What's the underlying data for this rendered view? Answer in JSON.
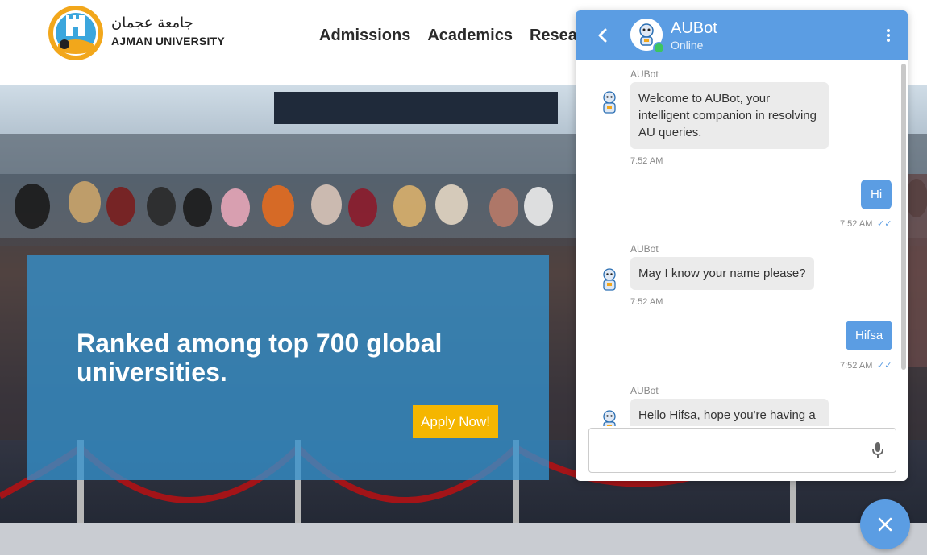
{
  "header": {
    "brand_ar": "جامعة عجمان",
    "brand_en": "AJMAN UNIVERSITY",
    "nav": [
      "Admissions",
      "Academics",
      "Resea"
    ]
  },
  "hero": {
    "title": "Ranked among top 700 global universities.",
    "apply_label": "Apply Now!"
  },
  "chat": {
    "bot_name": "AUBot",
    "status": "Online",
    "messages": [
      {
        "from": "bot",
        "sender": "AUBot",
        "text": "Welcome to AUBot, your intelligent companion in resolving AU queries.",
        "time": "7:52 AM"
      },
      {
        "from": "user",
        "text": "Hi",
        "time": "7:52 AM"
      },
      {
        "from": "bot",
        "sender": "AUBot",
        "text": "May I know your name please?",
        "time": "7:52 AM"
      },
      {
        "from": "user",
        "text": "Hifsa",
        "time": "7:52 AM"
      },
      {
        "from": "bot",
        "sender": "AUBot",
        "text": "Hello Hifsa, hope you're having a",
        "time": ""
      }
    ],
    "input_placeholder": ""
  },
  "colors": {
    "accent": "#5b9de3",
    "apply": "#f5b600",
    "card": "#3491cc",
    "online": "#3cc461"
  },
  "icons": [
    "logo-icon",
    "back-arrow-icon",
    "bot-avatar-icon",
    "more-vertical-icon",
    "microphone-icon",
    "close-icon",
    "double-check-icon"
  ]
}
